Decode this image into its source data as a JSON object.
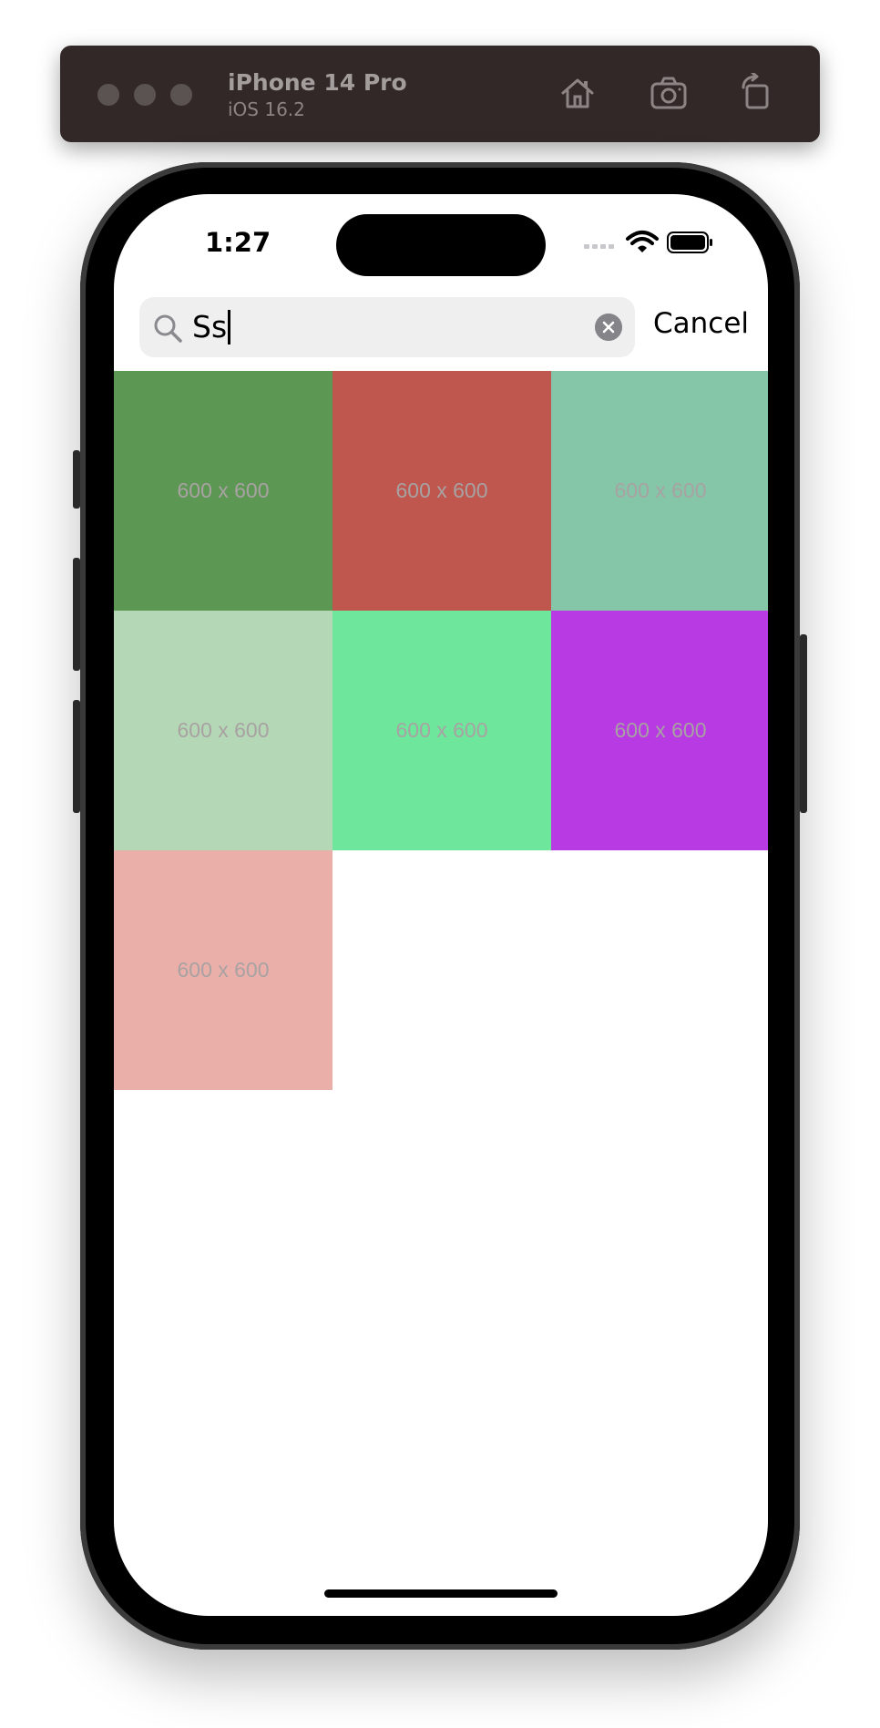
{
  "simulator": {
    "device_name": "iPhone 14 Pro",
    "os_version": "iOS 16.2"
  },
  "status_bar": {
    "time": "1:27"
  },
  "search": {
    "query": "Ss",
    "cancel_label": "Cancel"
  },
  "grid": {
    "tiles": [
      {
        "label": "600 x 600",
        "color": "#5c9753"
      },
      {
        "label": "600 x 600",
        "color": "#bf574e"
      },
      {
        "label": "600 x 600",
        "color": "#85c6a9"
      },
      {
        "label": "600 x 600",
        "color": "#b4d8b5"
      },
      {
        "label": "600 x 600",
        "color": "#6ee69b"
      },
      {
        "label": "600 x 600",
        "color": "#b73ae3"
      },
      {
        "label": "600 x 600",
        "color": "#ebafaa"
      }
    ]
  }
}
